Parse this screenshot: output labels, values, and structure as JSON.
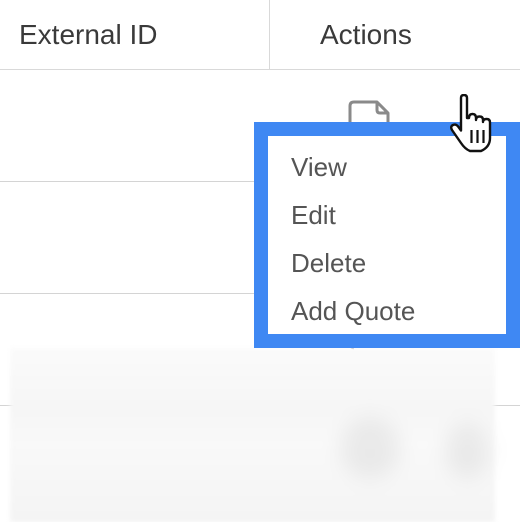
{
  "table": {
    "columns": [
      "External ID",
      "Actions"
    ]
  },
  "action_menu": {
    "items": [
      "View",
      "Edit",
      "Delete",
      "Add Quote"
    ],
    "accent_color": "#3f88f3"
  },
  "icons": {
    "row_action": "document-icon",
    "pointer": "hand-pointer-icon"
  }
}
